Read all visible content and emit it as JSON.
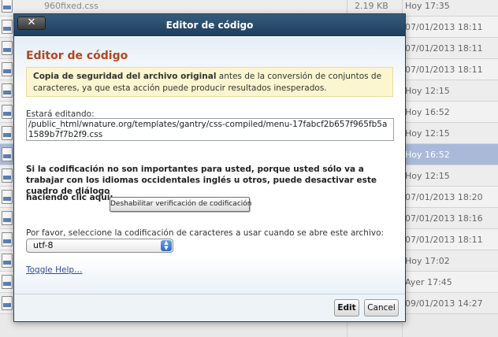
{
  "background_list": {
    "rows": [
      {
        "name": "960fixed.css",
        "size": "2.19 KB",
        "date": "Hoy 17:35",
        "selected": false
      },
      {
        "name": "",
        "size": "",
        "date": "07/01/2013 18:11",
        "selected": false
      },
      {
        "name": "",
        "size": "",
        "date": "07/01/2013 18:11",
        "selected": false
      },
      {
        "name": "",
        "size": "",
        "date": "07/01/2013 18:11",
        "selected": false
      },
      {
        "name": "",
        "size": "",
        "date": "Hoy 12:15",
        "selected": false
      },
      {
        "name": "",
        "size": "",
        "date": "Hoy 16:52",
        "selected": false
      },
      {
        "name": "",
        "size": "",
        "date": "Hoy 12:15",
        "selected": false
      },
      {
        "name": "",
        "size": "",
        "date": "Hoy 16:52",
        "selected": true
      },
      {
        "name": "",
        "size": "",
        "date": "Hoy 12:15",
        "selected": false
      },
      {
        "name": "",
        "size": "",
        "date": "07/01/2013 18:20",
        "selected": false
      },
      {
        "name": "",
        "size": "",
        "date": "07/01/2013 18:16",
        "selected": false
      },
      {
        "name": "",
        "size": "",
        "date": "07/01/2013 18:11",
        "selected": false
      },
      {
        "name": "",
        "size": "",
        "date": "Hoy 17:02",
        "selected": false
      },
      {
        "name": "",
        "size": "",
        "date": "Ayer 17:45",
        "selected": false
      },
      {
        "name": "",
        "size": "",
        "date": "09/01/2013 14:27",
        "selected": false
      }
    ]
  },
  "dialog": {
    "title": "Editor de código",
    "close_label": "✕",
    "heading": "Editor de código",
    "warning_bold": "Copia de seguridad del archivo original",
    "warning_text": " antes de la conversión de conjuntos de caracteres, ya que esta acción puede producir resultados inesperados.",
    "edit_label": "Estará editando:",
    "file_path": "/public_html/wnature.org/templates/gantry/css-compiled/menu-17fabcf2b657f965fb5a1589b7f7b2f9.css",
    "encoding_text": "Si la codificación no son importantes para usted, porque usted sólo va a trabajar con los idiomas occidentales inglés u otros, puede desactivar este cuadro de diálogo",
    "click_label": "haciendo clic aquí:",
    "disable_button": "Deshabilitar verificación de codificación",
    "charset_label": "Por favor, seleccione la codificación de caracteres a usar cuando se abre este archivo:",
    "charset_selected": "utf-8",
    "toggle_help": "Toggle Help…",
    "edit_button": "Edit",
    "cancel_button": "Cancel"
  },
  "colors": {
    "titlebar": "#1f4060",
    "heading": "#b5451b",
    "warning_bg": "#fbf6cf",
    "selected_row": "#aab9d9",
    "link": "#2f4a9a"
  },
  "icons": [
    "file-css-icon",
    "close-icon",
    "select-arrows-icon"
  ]
}
